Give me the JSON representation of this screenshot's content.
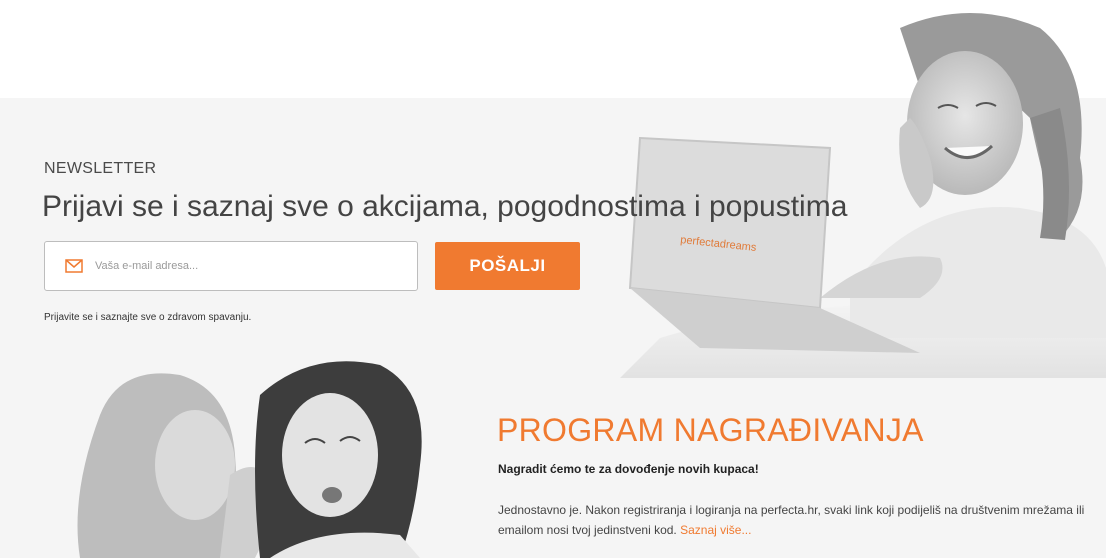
{
  "newsletter": {
    "kicker": "NEWSLETTER",
    "headline": "Prijavi se i saznaj sve o akcijama, pogodnostima i popustima",
    "email_placeholder": "Vaša e-mail adresa...",
    "submit_label": "POŠALJI",
    "note": "Prijavite se i saznajte sve o zdravom spavanju."
  },
  "laptop_brand": "perfectadreams",
  "rewards": {
    "title": "PROGRAM NAGRAĐIVANJA",
    "subtitle": "Nagradit ćemo te za dovođenje novih kupaca!",
    "body": "Jednostavno je. Nakon registriranja i logiranja na perfecta.hr, svaki link koji podijeliš na društvenim mrežama ili emailom nosi tvoj jedinstveni kod.",
    "link_label": "Saznaj više..."
  },
  "colors": {
    "accent": "#f07a30",
    "band": "#f5f5f5"
  },
  "icons": {
    "email": "envelope-icon"
  }
}
